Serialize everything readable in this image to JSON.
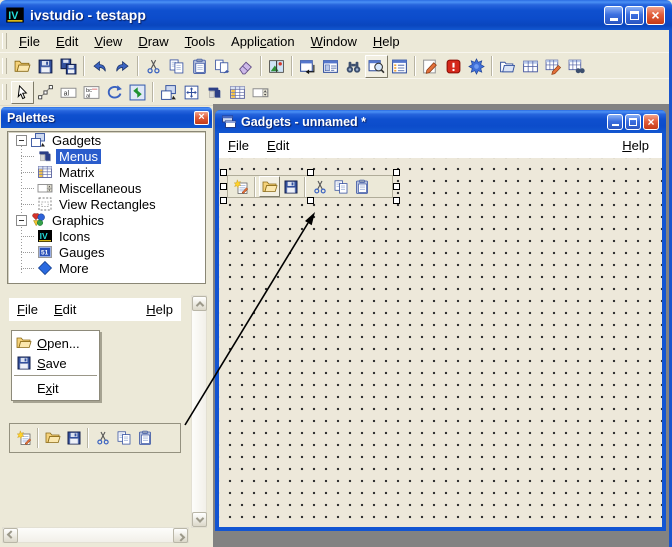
{
  "window": {
    "title": "ivstudio - testapp",
    "icon": "iv-logo-icon",
    "controls": [
      "minimize",
      "maximize",
      "close"
    ]
  },
  "menubar": {
    "items": [
      {
        "label": "File",
        "m": 0
      },
      {
        "label": "Edit",
        "m": 0
      },
      {
        "label": "View",
        "m": 0
      },
      {
        "label": "Draw",
        "m": 0
      },
      {
        "label": "Tools",
        "m": 0
      },
      {
        "label": "Application",
        "m": 5
      },
      {
        "label": "Window",
        "m": 0
      },
      {
        "label": "Help",
        "m": 0
      }
    ]
  },
  "toolbars": {
    "main": {
      "groups": [
        [
          "open",
          "save",
          "save-all"
        ],
        [
          "undo",
          "redo"
        ],
        [
          "cut",
          "copy",
          "paste",
          "duplicate",
          "erase"
        ],
        [
          "image"
        ],
        [
          "window-arrange",
          "form-view",
          "binoculars",
          "zoom-view",
          "details"
        ],
        [
          "draw-edit",
          "alert",
          "debug"
        ],
        [
          "scripts",
          "table",
          "table-edit",
          "table-find"
        ]
      ],
      "pressed": [
        "zoom-view"
      ]
    },
    "tools": {
      "groups": [
        [
          "select",
          "edit-points",
          "label",
          "multiline-label",
          "rotate",
          "refresh"
        ],
        [
          "bring-front",
          "fit",
          "menu",
          "matrix",
          "spinner"
        ]
      ],
      "pressed": [
        "select"
      ]
    }
  },
  "palettes": {
    "title": "Palettes",
    "tree": [
      {
        "label": "Gadgets",
        "icon": "gadgets",
        "depth": 0,
        "expander": "minus"
      },
      {
        "label": "Menus",
        "icon": "menu",
        "depth": 1,
        "selected": true
      },
      {
        "label": "Matrix",
        "icon": "matrix",
        "depth": 1
      },
      {
        "label": "Miscellaneous",
        "icon": "spinner",
        "depth": 1
      },
      {
        "label": "View Rectangles",
        "icon": "view-rect",
        "depth": 1
      },
      {
        "label": "Graphics",
        "icon": "graphics",
        "depth": 0,
        "expander": "minus"
      },
      {
        "label": "Icons",
        "icon": "iv-logo",
        "depth": 1
      },
      {
        "label": "Gauges",
        "icon": "gauge",
        "depth": 1
      },
      {
        "label": "More",
        "icon": "diamond",
        "depth": 1
      }
    ],
    "preview": {
      "menubar": [
        {
          "label": "File",
          "m": 0
        },
        {
          "label": "Edit",
          "m": 0
        },
        {
          "label": "Help",
          "m": 0,
          "right": true
        }
      ],
      "popup": {
        "items": [
          {
            "label": "Open...",
            "m": 0,
            "icon": "open"
          },
          {
            "label": "Save",
            "m": 0,
            "icon": "save"
          },
          {
            "separator": true
          },
          {
            "label": "Exit",
            "m": 1
          }
        ]
      },
      "toolbar": {
        "groups": [
          [
            "new"
          ],
          [
            "open",
            "save"
          ],
          [
            "cut",
            "copy",
            "paste"
          ]
        ],
        "pressed": []
      }
    }
  },
  "child_window": {
    "title": "Gadgets - unnamed *",
    "icon": "window-frames-icon",
    "controls": [
      "minimize",
      "maximize",
      "close"
    ],
    "menubar": {
      "left": [
        {
          "label": "File",
          "m": 0
        },
        {
          "label": "Edit",
          "m": 0
        }
      ],
      "right": [
        {
          "label": "Help",
          "m": 0
        }
      ]
    },
    "toolbar_widget": {
      "groups": [
        [
          "new"
        ],
        [
          "open",
          "save"
        ],
        [
          "cut",
          "copy",
          "paste"
        ]
      ],
      "pressed": [
        "open"
      ],
      "selected": true
    }
  },
  "colors": {
    "titlebar": "#0f50cf",
    "titlebar_highlight": "#4a90f5",
    "close_button": "#d6492a",
    "panel": "#ece9d8",
    "mdi_background": "#828282",
    "selection": "#2a5ccc",
    "window_border": "#1355d2",
    "canvas_dot": "#2c2c2c"
  }
}
